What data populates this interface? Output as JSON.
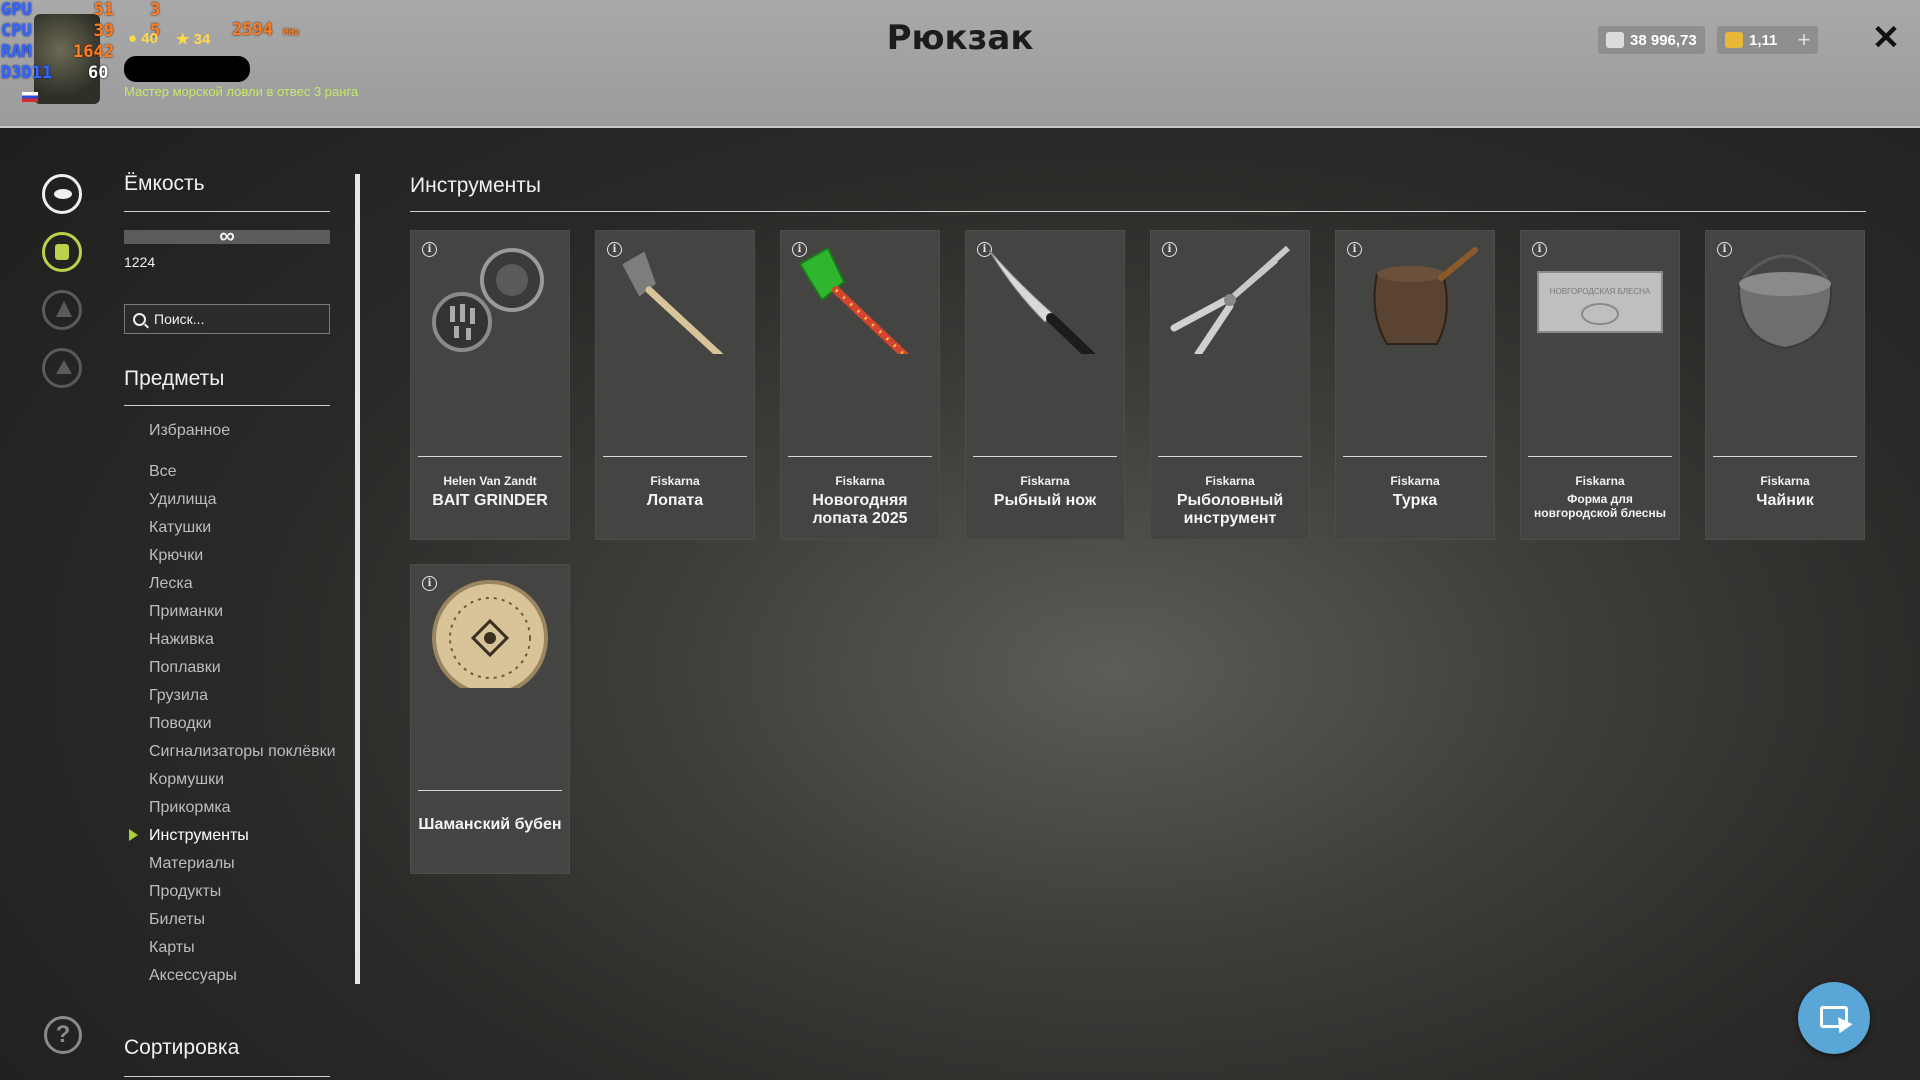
{
  "window": {
    "title": "Рюкзак"
  },
  "hud": {
    "labels": [
      "GPU",
      "CPU",
      "RAM",
      "D3D11"
    ],
    "gpu_temp": "51",
    "cpu_temp": "39",
    "ram_mb": "1642",
    "fps": "60",
    "gpu_load": "3",
    "cpu_load": "5",
    "gpu_clock": "2594",
    "clock_unit": "MHz"
  },
  "player": {
    "level": "40",
    "stars": "34",
    "title": "Мастер морской ловли в отвес 3 ранга"
  },
  "currency": {
    "silver": "38 996,73",
    "gold": "1,11",
    "add_label": "+",
    "close_label": "✕"
  },
  "capacity": {
    "heading": "Ёмкость",
    "limit_symbol": "∞",
    "count": "1224"
  },
  "search": {
    "placeholder": "Поиск..."
  },
  "items_heading": "Предметы",
  "favorites": "Избранное",
  "categories": [
    "Все",
    "Удилища",
    "Катушки",
    "Крючки",
    "Леска",
    "Приманки",
    "Наживка",
    "Поплавки",
    "Грузила",
    "Поводки",
    "Сигнализаторы поклёвки",
    "Кормушки",
    "Прикормка",
    "Инструменты",
    "Материалы",
    "Продукты",
    "Билеты",
    "Карты",
    "Аксессуары"
  ],
  "active_category": "Инструменты",
  "sort_heading": "Сортировка",
  "main_heading": "Инструменты",
  "help_label": "?",
  "items": [
    {
      "brand": "Helen Van Zandt",
      "name": "BAIT GRINDER",
      "icon": "grinder-icon"
    },
    {
      "brand": "Fiskarna",
      "name": "Лопата",
      "icon": "shovel-icon"
    },
    {
      "brand": "Fiskarna",
      "name": "Новогодняя лопата 2025",
      "icon": "green-shovel-icon"
    },
    {
      "brand": "Fiskarna",
      "name": "Рыбный нож",
      "icon": "fish-knife-icon"
    },
    {
      "brand": "Fiskarna",
      "name": "Рыболовный инструмент",
      "icon": "pliers-icon"
    },
    {
      "brand": "Fiskarna",
      "name": "Турка",
      "icon": "turka-icon"
    },
    {
      "brand": "Fiskarna",
      "name": "Форма для новгородской блесны",
      "icon": "mold-icon",
      "plate_text": "НОВГОРОДСКАЯ БЛЕСНА"
    },
    {
      "brand": "Fiskarna",
      "name": "Чайник",
      "icon": "kettle-icon"
    },
    {
      "brand": "",
      "name": "Шаманский бубен",
      "icon": "drum-icon"
    }
  ]
}
